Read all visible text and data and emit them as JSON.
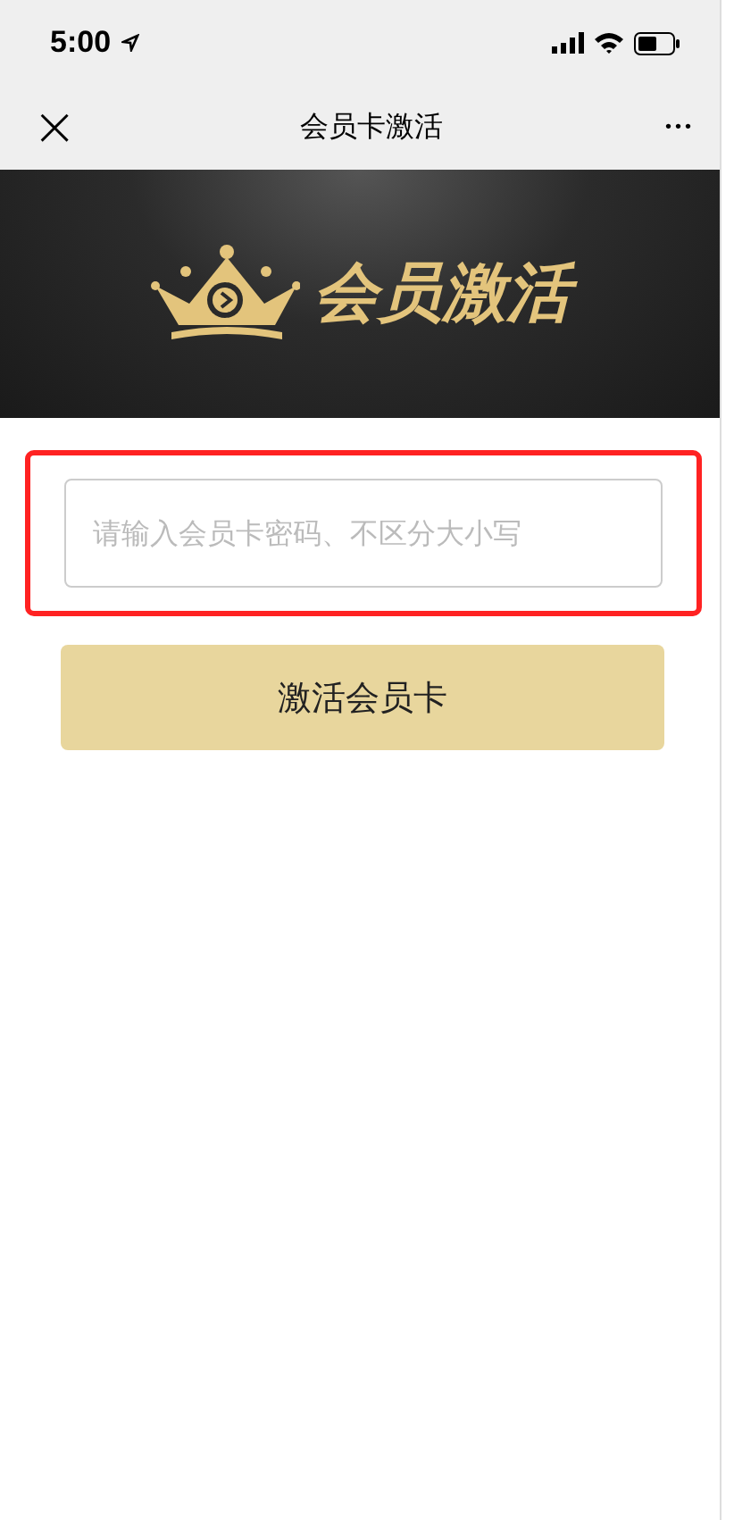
{
  "status_bar": {
    "time": "5:00"
  },
  "nav": {
    "close": "×",
    "title": "会员卡激活",
    "more": "•••"
  },
  "banner": {
    "logo_text": "会员激活"
  },
  "card_field": {
    "placeholder": "请输入会员卡密码、不区分大小写",
    "highlighted": true
  },
  "activate_button": {
    "label": "激活会员卡"
  }
}
